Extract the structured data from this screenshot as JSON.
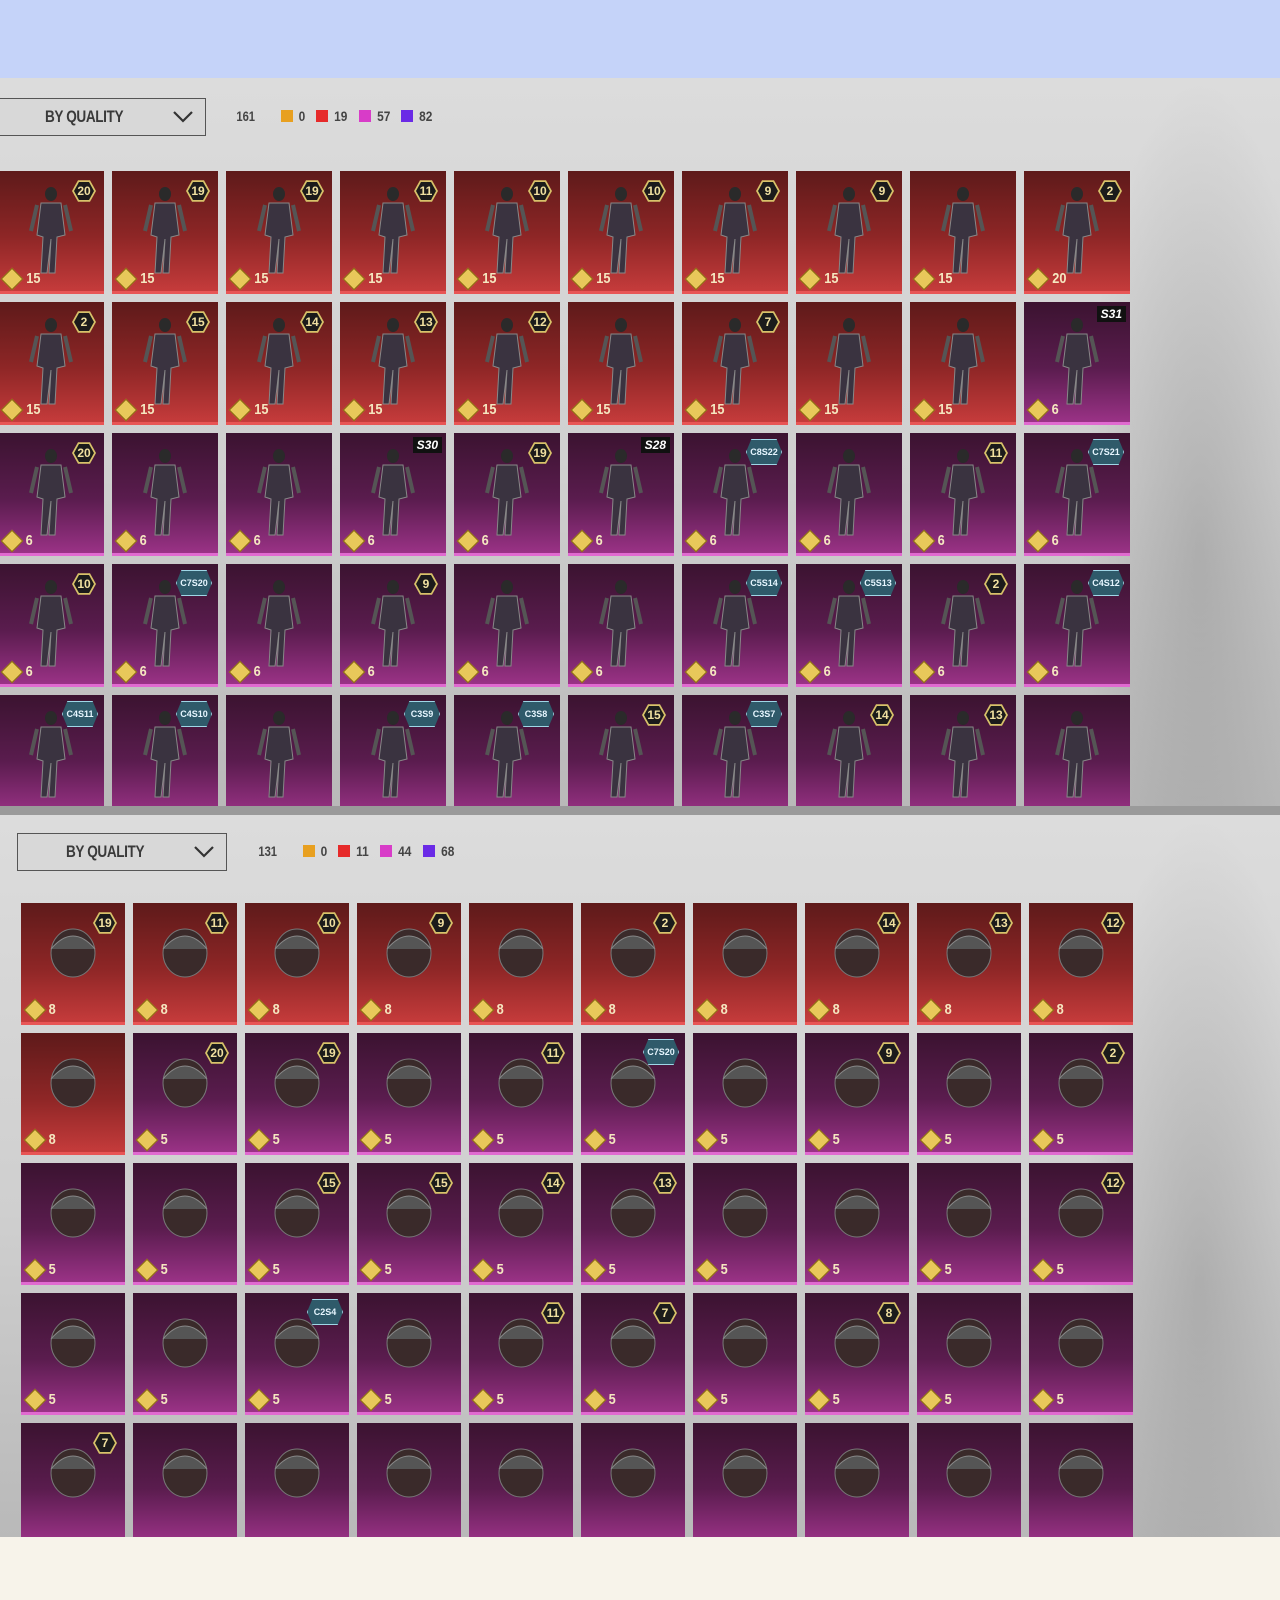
{
  "colors": {
    "gold": "#e8a020",
    "red": "#e62a2a",
    "pink": "#d83cc8",
    "purple": "#6a2ae6"
  },
  "outfits": {
    "sort_label": "BY QUALITY",
    "total": "161",
    "counts": [
      {
        "color": "gold",
        "value": "0"
      },
      {
        "color": "red",
        "value": "19"
      },
      {
        "color": "pink",
        "value": "57"
      },
      {
        "color": "purple",
        "value": "82"
      }
    ],
    "items": [
      {
        "q": "red",
        "cost": "15",
        "badge": "20"
      },
      {
        "q": "red",
        "cost": "15",
        "badge": "19"
      },
      {
        "q": "red",
        "cost": "15",
        "badge": "19"
      },
      {
        "q": "red",
        "cost": "15",
        "badge": "11"
      },
      {
        "q": "red",
        "cost": "15",
        "badge": "10"
      },
      {
        "q": "red",
        "cost": "15",
        "badge": "10"
      },
      {
        "q": "red",
        "cost": "15",
        "badge": "9"
      },
      {
        "q": "red",
        "cost": "15",
        "badge": "9"
      },
      {
        "q": "red",
        "cost": "15"
      },
      {
        "q": "red",
        "cost": "20",
        "badge": "2"
      },
      {
        "q": "red",
        "cost": "15",
        "badge": "2"
      },
      {
        "q": "red",
        "cost": "15",
        "badge": "15"
      },
      {
        "q": "red",
        "cost": "15",
        "badge": "14"
      },
      {
        "q": "red",
        "cost": "15",
        "badge": "13"
      },
      {
        "q": "red",
        "cost": "15",
        "badge": "12"
      },
      {
        "q": "red",
        "cost": "15"
      },
      {
        "q": "red",
        "cost": "15",
        "badge": "7"
      },
      {
        "q": "red",
        "cost": "15"
      },
      {
        "q": "red",
        "cost": "15"
      },
      {
        "q": "purple",
        "cost": "6",
        "tag": "S31"
      },
      {
        "q": "purple",
        "cost": "6",
        "badge": "20"
      },
      {
        "q": "purple",
        "cost": "6"
      },
      {
        "q": "purple",
        "cost": "6"
      },
      {
        "q": "purple",
        "cost": "6",
        "tag": "S30"
      },
      {
        "q": "purple",
        "cost": "6",
        "badge": "19"
      },
      {
        "q": "purple",
        "cost": "6",
        "tag": "S28"
      },
      {
        "q": "purple",
        "cost": "6",
        "code": "C8S22"
      },
      {
        "q": "purple",
        "cost": "6"
      },
      {
        "q": "purple",
        "cost": "6",
        "badge": "11"
      },
      {
        "q": "purple",
        "cost": "6",
        "code": "C7S21"
      },
      {
        "q": "purple",
        "cost": "6",
        "badge": "10"
      },
      {
        "q": "purple",
        "cost": "6",
        "code": "C7S20"
      },
      {
        "q": "purple",
        "cost": "6"
      },
      {
        "q": "purple",
        "cost": "6",
        "badge": "9"
      },
      {
        "q": "purple",
        "cost": "6"
      },
      {
        "q": "purple",
        "cost": "6"
      },
      {
        "q": "purple",
        "cost": "6",
        "code": "C5S14"
      },
      {
        "q": "purple",
        "cost": "6",
        "code": "C5S13"
      },
      {
        "q": "purple",
        "cost": "6",
        "badge": "2"
      },
      {
        "q": "purple",
        "cost": "6",
        "code": "C4S12"
      },
      {
        "q": "purple",
        "code": "C4S11"
      },
      {
        "q": "purple",
        "code": "C4S10"
      },
      {
        "q": "purple"
      },
      {
        "q": "purple",
        "code": "C3S9"
      },
      {
        "q": "purple",
        "code": "C3S8"
      },
      {
        "q": "purple",
        "badge": "15"
      },
      {
        "q": "purple",
        "code": "C3S7"
      },
      {
        "q": "purple",
        "badge": "14"
      },
      {
        "q": "purple",
        "badge": "13"
      },
      {
        "q": "purple"
      }
    ]
  },
  "headwear": {
    "sort_label": "BY QUALITY",
    "total": "131",
    "counts": [
      {
        "color": "gold",
        "value": "0"
      },
      {
        "color": "red",
        "value": "11"
      },
      {
        "color": "pink",
        "value": "44"
      },
      {
        "color": "purple",
        "value": "68"
      }
    ],
    "items": [
      {
        "q": "red",
        "cost": "8",
        "badge": "19"
      },
      {
        "q": "red",
        "cost": "8",
        "badge": "11"
      },
      {
        "q": "red",
        "cost": "8",
        "badge": "10"
      },
      {
        "q": "red",
        "cost": "8",
        "badge": "9"
      },
      {
        "q": "red",
        "cost": "8"
      },
      {
        "q": "red",
        "cost": "8",
        "badge": "2"
      },
      {
        "q": "red",
        "cost": "8"
      },
      {
        "q": "red",
        "cost": "8",
        "badge": "14"
      },
      {
        "q": "red",
        "cost": "8",
        "badge": "13"
      },
      {
        "q": "red",
        "cost": "8",
        "badge": "12"
      },
      {
        "q": "red",
        "cost": "8"
      },
      {
        "q": "purple",
        "cost": "5",
        "badge": "20"
      },
      {
        "q": "purple",
        "cost": "5",
        "badge": "19"
      },
      {
        "q": "purple",
        "cost": "5"
      },
      {
        "q": "purple",
        "cost": "5",
        "badge": "11"
      },
      {
        "q": "purple",
        "cost": "5",
        "code": "C7S20"
      },
      {
        "q": "purple",
        "cost": "5"
      },
      {
        "q": "purple",
        "cost": "5",
        "badge": "9"
      },
      {
        "q": "purple",
        "cost": "5"
      },
      {
        "q": "purple",
        "cost": "5",
        "badge": "2"
      },
      {
        "q": "purple",
        "cost": "5"
      },
      {
        "q": "purple",
        "cost": "5"
      },
      {
        "q": "purple",
        "cost": "5",
        "badge": "15"
      },
      {
        "q": "purple",
        "cost": "5",
        "badge": "15"
      },
      {
        "q": "purple",
        "cost": "5",
        "badge": "14"
      },
      {
        "q": "purple",
        "cost": "5",
        "badge": "13"
      },
      {
        "q": "purple",
        "cost": "5"
      },
      {
        "q": "purple",
        "cost": "5"
      },
      {
        "q": "purple",
        "cost": "5"
      },
      {
        "q": "purple",
        "cost": "5",
        "badge": "12"
      },
      {
        "q": "purple",
        "cost": "5"
      },
      {
        "q": "purple",
        "cost": "5"
      },
      {
        "q": "purple",
        "cost": "5",
        "code": "C2S4"
      },
      {
        "q": "purple",
        "cost": "5"
      },
      {
        "q": "purple",
        "cost": "5",
        "badge": "11"
      },
      {
        "q": "purple",
        "cost": "5",
        "badge": "7"
      },
      {
        "q": "purple",
        "cost": "5"
      },
      {
        "q": "purple",
        "cost": "5",
        "badge": "8"
      },
      {
        "q": "purple",
        "cost": "5"
      },
      {
        "q": "purple",
        "cost": "5"
      },
      {
        "q": "purple",
        "badge": "7"
      },
      {
        "q": "purple"
      },
      {
        "q": "purple"
      },
      {
        "q": "purple"
      },
      {
        "q": "purple"
      },
      {
        "q": "purple"
      },
      {
        "q": "purple"
      },
      {
        "q": "purple"
      },
      {
        "q": "purple"
      },
      {
        "q": "purple"
      }
    ]
  }
}
